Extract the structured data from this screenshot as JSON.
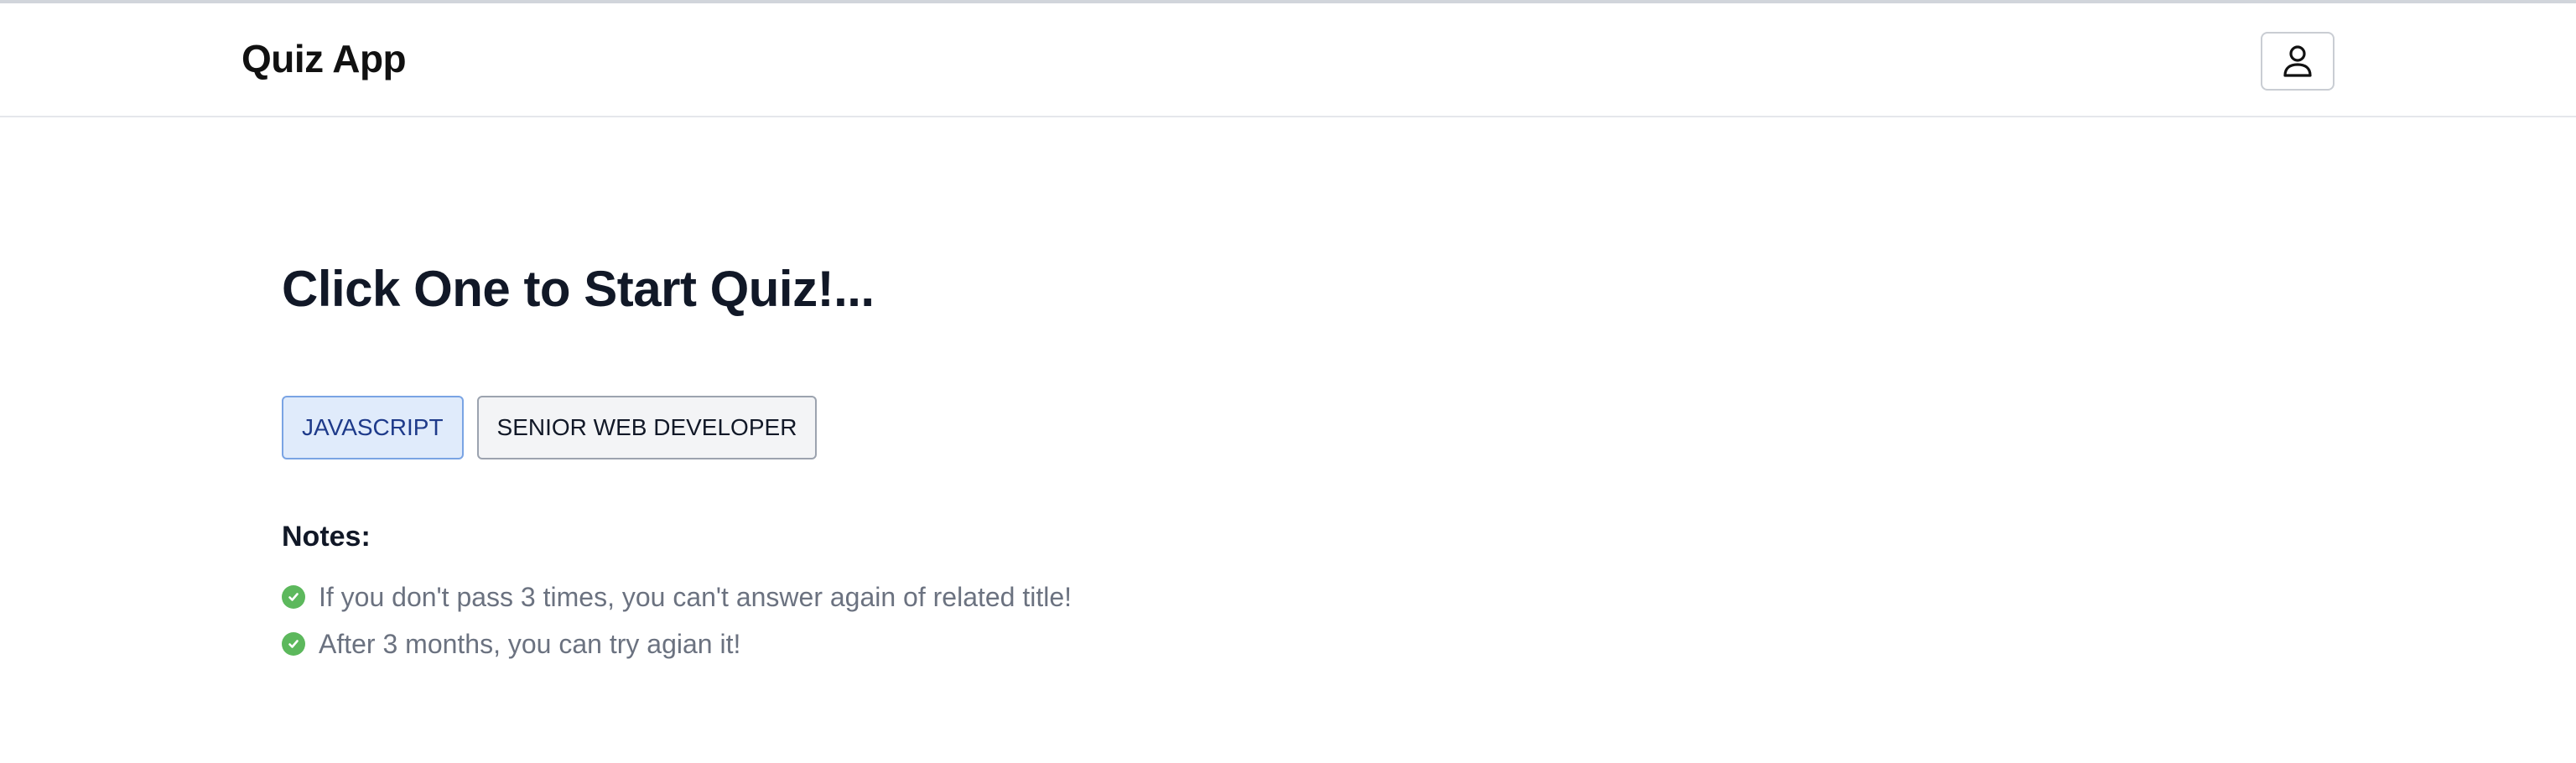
{
  "app": {
    "title": "Quiz App"
  },
  "header": {
    "user_icon": "user-icon"
  },
  "main": {
    "heading": "Click One to Start Quiz!...",
    "quiz_buttons": [
      {
        "label": "JAVASCRIPT",
        "selected": true
      },
      {
        "label": "SENIOR WEB DEVELOPER",
        "selected": false
      }
    ],
    "notes_title": "Notes:",
    "notes": [
      "If you don't pass 3 times, you can't answer again of related title!",
      "After 3 months, you can try agian it!"
    ],
    "note_icon": "check-circle-icon"
  },
  "colors": {
    "check_green": "#5cb85c",
    "selected_bg": "#e0ebfb",
    "selected_border": "#7aa4e4",
    "selected_text": "#1e3a8a"
  }
}
